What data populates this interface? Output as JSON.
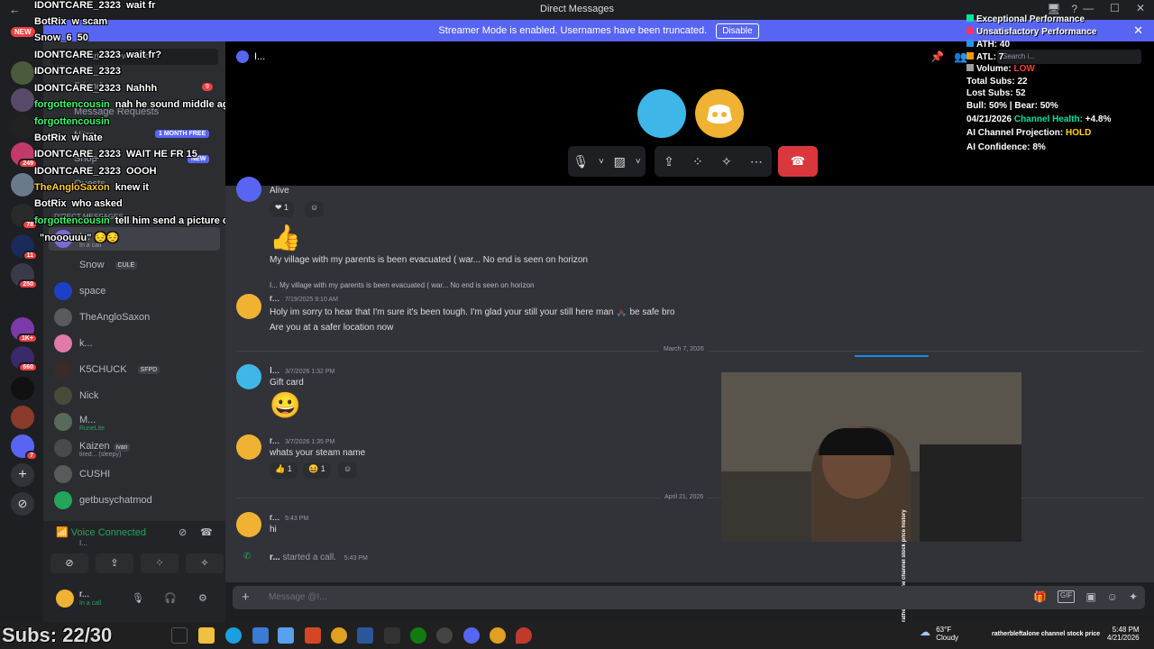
{
  "titlebar": {
    "title": "Direct Messages",
    "back": "←",
    "icons": [
      "🖥",
      "?"
    ],
    "winbtns": [
      "—",
      "☐",
      "✕"
    ]
  },
  "banner": {
    "text": "Streamer Mode is enabled. Usernames have been truncated.",
    "button": "Disable",
    "close": "✕"
  },
  "rail": {
    "new_label": "NEW",
    "badges": [
      "249",
      "78",
      "11",
      "250",
      "1K+",
      "660",
      "7"
    ],
    "add": "+",
    "discover": "⊘"
  },
  "sidebar": {
    "search_placeholder": "Find or start a conversation",
    "nav": [
      "Friends",
      "Message Requests",
      "Nitro",
      "Shop",
      "Quests"
    ],
    "nav_badge": "9",
    "nitro_tag": "1 MONTH FREE",
    "shop_tag": "NEW",
    "dm_header": "Direct Messages",
    "dms": [
      {
        "name": "I...",
        "sub": "In a call",
        "tag": ""
      },
      {
        "name": "Snow",
        "sub": "",
        "tag": "CULĖ"
      },
      {
        "name": "space",
        "sub": "",
        "tag": ""
      },
      {
        "name": "TheAngloSaxon",
        "sub": "",
        "tag": ""
      },
      {
        "name": "k...",
        "sub": "",
        "tag": ""
      },
      {
        "name": "K5CHUCK",
        "sub": "",
        "tag": "SFPD"
      },
      {
        "name": "Nick",
        "sub": "",
        "tag": ""
      },
      {
        "name": "M...",
        "sub": "RuneLite",
        "tag": ""
      },
      {
        "name": "Kaizen",
        "sub": "tired... (sleepy)",
        "tag": "ivan"
      },
      {
        "name": "CUSHI",
        "sub": "",
        "tag": ""
      },
      {
        "name": "getbusychatmod",
        "sub": "",
        "tag": ""
      }
    ],
    "voice": {
      "status": "Voice Connected",
      "channel": "I...",
      "buttons": [
        "⊘",
        "⇪",
        "⁘",
        "✧"
      ]
    },
    "user": {
      "name": "r...",
      "status": "In a call"
    }
  },
  "overlay": [
    {
      "user": "IDONTCARE_2323",
      "msg": "wait fr",
      "color": "#ffffff"
    },
    {
      "user": "BotRix",
      "msg": "w scam",
      "color": "#ffffff"
    },
    {
      "user": "Snow_6",
      "msg": "50",
      "color": "#ffffff"
    },
    {
      "user": "IDONTCARE_2323",
      "msg": "wait fr?",
      "color": "#ffffff"
    },
    {
      "user": "IDONTCARE_2323",
      "msg": "",
      "color": "#ffffff"
    },
    {
      "user": "IDONTCARE_2323",
      "msg": "Nahhh",
      "color": "#ffffff"
    },
    {
      "user": "forgottencousin",
      "msg": "nah he sound middle aged",
      "color": "#33ff66"
    },
    {
      "user": "forgottencousin",
      "msg": "",
      "color": "#33ff66"
    },
    {
      "user": "BotRix",
      "msg": "w hate",
      "color": "#ffffff"
    },
    {
      "user": "IDONTCARE_2323",
      "msg": "WAIT HE FR 15",
      "color": "#ffffff"
    },
    {
      "user": "IDONTCARE_2323",
      "msg": "OOOH",
      "color": "#ffffff"
    },
    {
      "user": "TheAngloSaxon",
      "msg": "knew it",
      "color": "#ffcc33"
    },
    {
      "user": "BotRix",
      "msg": "who asked",
      "color": "#ffffff"
    },
    {
      "user": "forgottencousin",
      "msg": "tell him send a picture of the rubble",
      "color": "#33ff66"
    },
    {
      "user": "",
      "msg": "\"nooouuu\" 😔😔",
      "color": "#ffffff"
    }
  ],
  "call": {
    "header": "I...",
    "search_placeholder": "Search i...",
    "controls": [
      "🎙",
      "˅",
      "▨",
      "˅",
      "⇪",
      "⁘",
      "✧",
      "⋯"
    ],
    "hangup": "☎"
  },
  "stats": {
    "legend": [
      {
        "label": "Exceptional Performance",
        "color": "#00e5a0"
      },
      {
        "label": "Unsatisfactory Performance",
        "color": "#ff3366"
      },
      {
        "label": "ATH: 40",
        "color": "#2196f3"
      },
      {
        "label": "ATL: 7",
        "color": "#ff9800"
      },
      {
        "label": "Volume: ",
        "color": "#9e9e9e"
      }
    ],
    "volume_value": "LOW",
    "total_subs": "Total Subs: 22",
    "lost_subs": "Lost Subs: 52",
    "bull_bear": "Bull: 50% | Bear: 50%",
    "health_date": "04/21/2026",
    "health_label": "Channel Health:",
    "health_value": "+4.8%",
    "projection_label": "AI Channel Projection:",
    "projection_value": "HOLD",
    "confidence": "AI Confidence: 8%"
  },
  "messages": {
    "alive": "Alive",
    "react_heart": "❤ 1",
    "thumb": "👍",
    "village": "My village with my parents is been evacuated ( war... No end is seen on horizon",
    "reply_preview": "I... My village with my parents is been evacuated ( war... No end is seen on horizon",
    "r_name": "r...",
    "r_time1": "7/19/2025 9:10 AM",
    "r_text1": "Holy im sorry to hear that I'm sure it's been tough. I'm glad your still your still here man 🙏🏿 be safe bro",
    "r_text2": "Are you at a safer location now",
    "div1": "March 7, 2026",
    "i_name": "I...",
    "i_time": "3/7/2026 1:32 PM",
    "i_text": "Gift card",
    "smiley": "😀",
    "r_time2": "3/7/2026 1:35 PM",
    "r_text3": "whats your steam name",
    "react_thumb": "👍 1",
    "react_laugh": "😆 1",
    "div2": "April 21, 2026",
    "r_time3": "5:43 PM",
    "r_text4": "hi",
    "call_user": "r...",
    "call_text": "started a call.",
    "call_time": "5:43 PM"
  },
  "input": {
    "placeholder": "Message @I...",
    "plus": "+",
    "icons": [
      "🎁",
      "GIF",
      "▣",
      "☺",
      "✦"
    ]
  },
  "stream": {
    "vertical_text": "ratherbleftalone channel stock price history"
  },
  "taskbar": {
    "subs": "Subs: 22/30",
    "weather_temp": "63°F",
    "weather_desc": "Cloudy",
    "tray_text": "ratherbleftalone channel stock price",
    "time": "5:48 PM",
    "date": "4/21/2026"
  }
}
